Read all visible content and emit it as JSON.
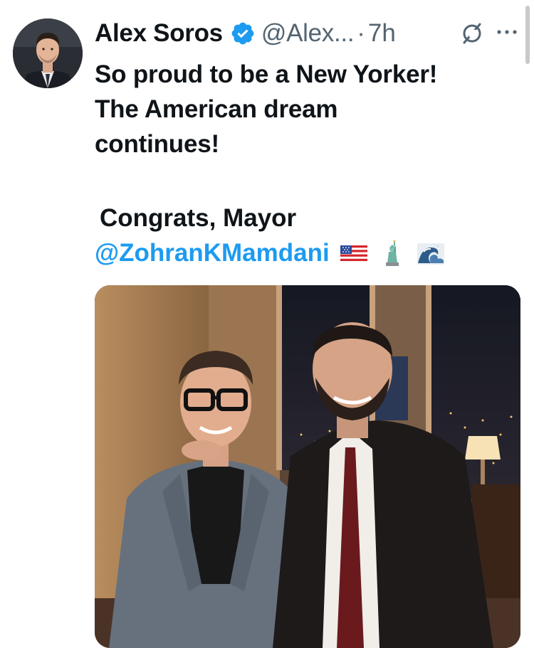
{
  "author": {
    "name": "Alex Soros",
    "handle": "@Alex...",
    "separator": "·",
    "time": "7h",
    "verified": true,
    "avatar_icon": "profile-photo"
  },
  "actions": {
    "grok_icon": "grok-icon",
    "more_icon": "more-options-icon"
  },
  "tweet": {
    "lines": [
      "So proud to be a New Yorker!",
      "The American dream",
      "continues!"
    ],
    "congrats": "Congrats, Mayor",
    "mention": "@ZohranKMamdani",
    "emojis": [
      "us-flag",
      "statue-of-liberty",
      "wave"
    ]
  },
  "media": {
    "kind": "photo",
    "subject": "two-men-posing-indoors"
  },
  "colors": {
    "accent": "#1d9bf0",
    "text": "#0f1419",
    "secondary": "#536471"
  }
}
